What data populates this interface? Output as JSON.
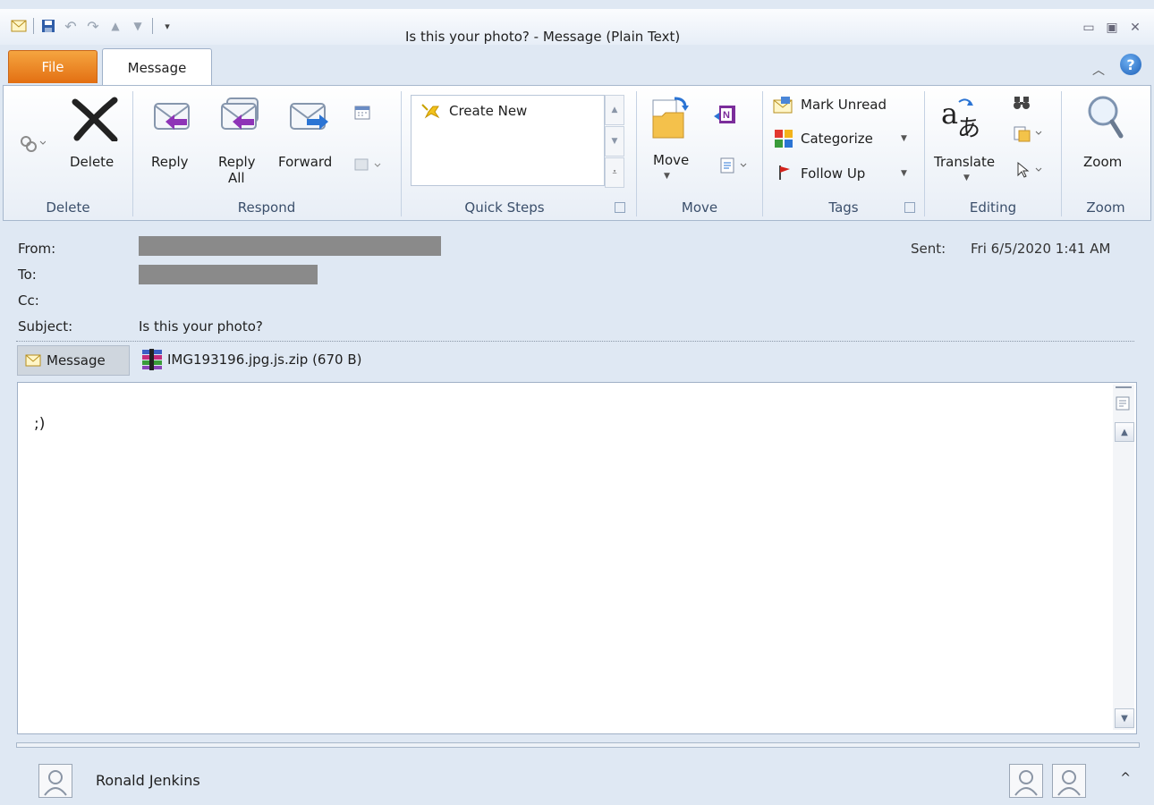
{
  "window": {
    "title": "Is this your photo?  - Message (Plain Text)"
  },
  "tabs": {
    "file": "File",
    "message": "Message"
  },
  "ribbon": {
    "delete_group": {
      "label": "Delete",
      "delete_button": "Delete"
    },
    "respond_group": {
      "label": "Respond",
      "reply": "Reply",
      "reply_all_line1": "Reply",
      "reply_all_line2": "All",
      "forward": "Forward"
    },
    "quick_steps": {
      "label": "Quick Steps",
      "create_new": "Create New"
    },
    "move_group": {
      "label": "Move",
      "move": "Move"
    },
    "tags_group": {
      "label": "Tags",
      "mark_unread": "Mark Unread",
      "categorize": "Categorize",
      "follow_up": "Follow Up"
    },
    "editing_group": {
      "label": "Editing",
      "translate": "Translate"
    },
    "zoom_group": {
      "label": "Zoom",
      "zoom": "Zoom"
    }
  },
  "header": {
    "from_label": "From:",
    "to_label": "To:",
    "cc_label": "Cc:",
    "subject_label": "Subject:",
    "subject_value": "Is this your photo?",
    "sent_label": "Sent:",
    "sent_value": "Fri 6/5/2020 1:41 AM"
  },
  "attachments": {
    "message_tab": "Message",
    "file": "IMG193196.jpg.js.zip (670 B)"
  },
  "body": {
    "text": ";)"
  },
  "people_pane": {
    "name": "Ronald Jenkins"
  }
}
